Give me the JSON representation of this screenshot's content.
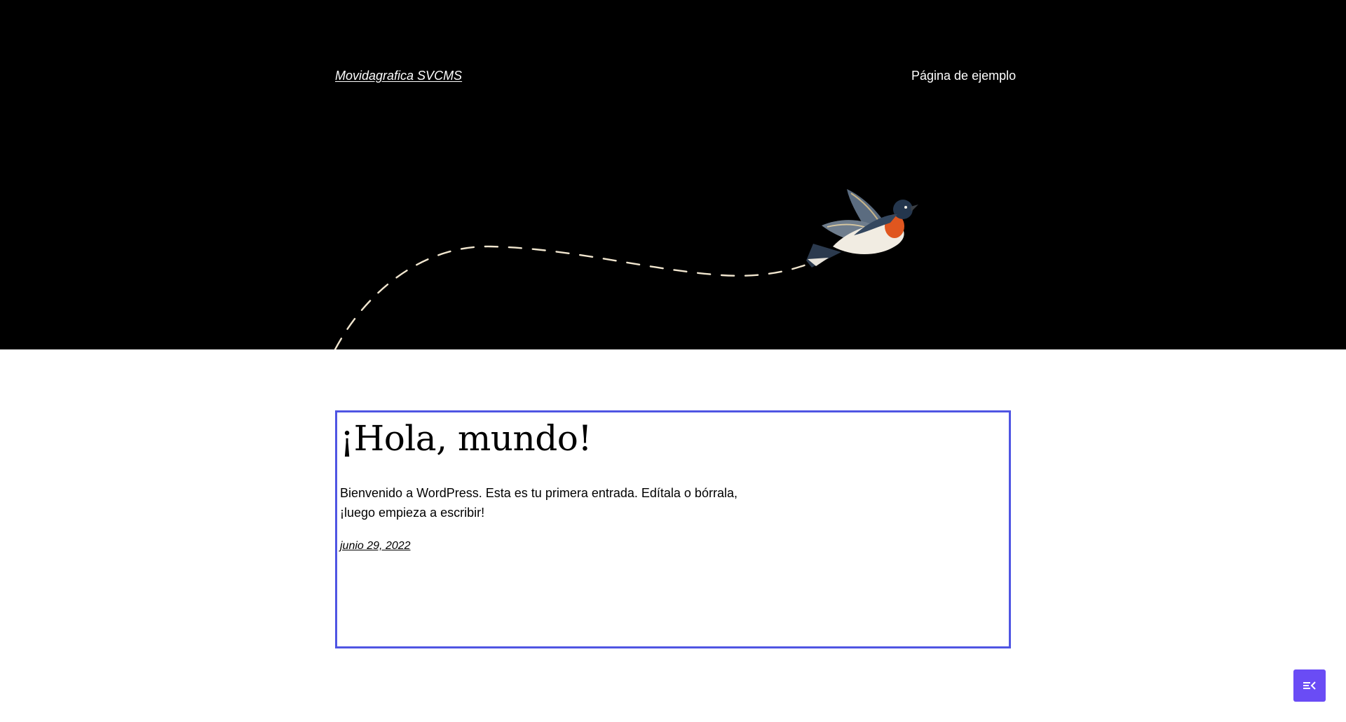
{
  "header": {
    "site_title": "Movidagrafica SVCMS",
    "nav": [
      {
        "label": "Página de ejemplo"
      }
    ]
  },
  "post": {
    "title": "¡Hola, mundo!",
    "excerpt": "Bienvenido a WordPress. Esta es tu primera entrada. Edítala o bórrala, ¡luego empieza a escribir!",
    "date": "junio 29, 2022"
  },
  "colors": {
    "header_bg": "#000000",
    "selection_outline": "#4f55e3",
    "fab_bg": "#6a4cf5",
    "dashed_path": "#f1e6cf"
  },
  "icons": {
    "hero_illustration": "flying-bird",
    "fab": "list-view-icon"
  }
}
